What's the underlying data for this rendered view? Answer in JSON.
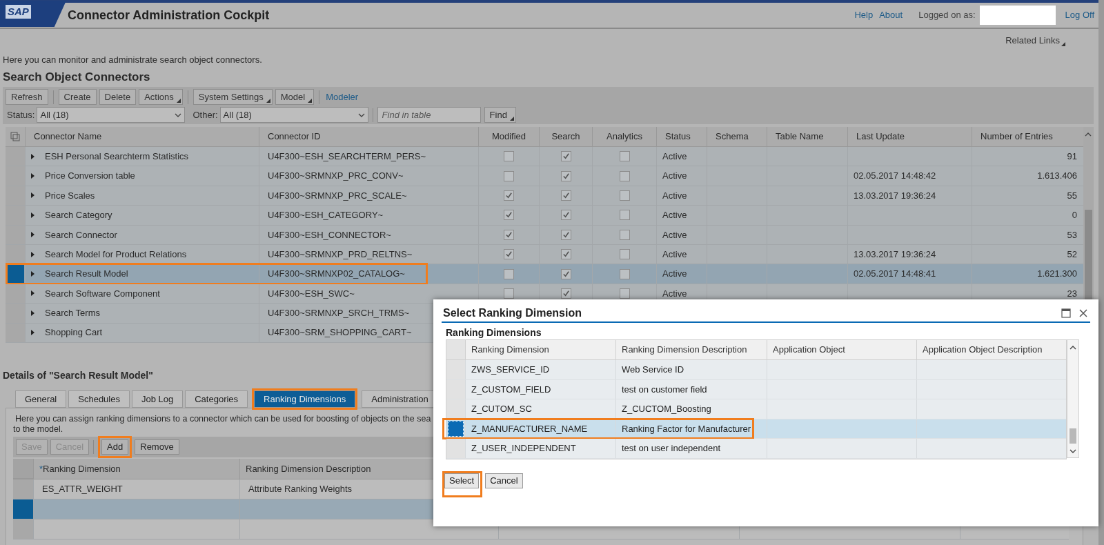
{
  "header": {
    "logo_text": "SAP",
    "title": "Connector Administration Cockpit",
    "links": [
      "Help",
      "About"
    ],
    "logged_on_label": "Logged on as:",
    "log_off": "Log Off"
  },
  "related_links": "Related Links",
  "intro": "Here you can monitor and administrate search object connectors.",
  "connectors": {
    "title": "Search Object Connectors",
    "toolbar_groups": [
      [
        {
          "kind": "button",
          "label": "Refresh"
        }
      ],
      [
        {
          "kind": "button",
          "label": "Create"
        },
        {
          "kind": "button",
          "label": "Delete"
        },
        {
          "kind": "menu",
          "label": "Actions"
        }
      ],
      [
        {
          "kind": "menu",
          "label": "System Settings"
        },
        {
          "kind": "menu",
          "label": "Model"
        }
      ],
      [
        {
          "kind": "link",
          "label": "Modeler"
        }
      ]
    ],
    "filters": [
      {
        "label": "Status:",
        "value": "All (18)"
      },
      {
        "label": "Other:",
        "value": "All (18)"
      }
    ],
    "find": {
      "placeholder": "Find in table",
      "button": "Find"
    },
    "columns": [
      "Connector Name",
      "Connector ID",
      "Modified",
      "Search",
      "Analytics",
      "Status",
      "Schema",
      "Table Name",
      "Last Update",
      "Number of Entries"
    ],
    "rows": [
      {
        "name": "ESH Personal Searchterm Statistics",
        "id": "U4F300~ESH_SEARCHTERM_PERS~",
        "modified": false,
        "search": true,
        "analytics": false,
        "status": "Active",
        "entries": "91",
        "selected": false,
        "highlighted": false
      },
      {
        "name": "Price Conversion table",
        "id": "U4F300~SRMNXP_PRC_CONV~",
        "modified": false,
        "search": true,
        "analytics": false,
        "status": "Active",
        "last_update": "02.05.2017 14:48:42",
        "entries": "1.613.406",
        "selected": false,
        "highlighted": false
      },
      {
        "name": "Price Scales",
        "id": "U4F300~SRMNXP_PRC_SCALE~",
        "modified": true,
        "search": true,
        "analytics": false,
        "status": "Active",
        "last_update": "13.03.2017 19:36:24",
        "entries": "55",
        "selected": false,
        "highlighted": false
      },
      {
        "name": "Search Category",
        "id": "U4F300~ESH_CATEGORY~",
        "modified": true,
        "search": true,
        "analytics": false,
        "status": "Active",
        "entries": "0",
        "selected": false,
        "highlighted": false
      },
      {
        "name": "Search Connector",
        "id": "U4F300~ESH_CONNECTOR~",
        "modified": true,
        "search": true,
        "analytics": false,
        "status": "Active",
        "entries": "53",
        "selected": false,
        "highlighted": false
      },
      {
        "name": "Search Model for Product Relations",
        "id": "U4F300~SRMNXP_PRD_RELTNS~",
        "modified": true,
        "search": true,
        "analytics": false,
        "status": "Active",
        "last_update": "13.03.2017 19:36:24",
        "entries": "52",
        "selected": false,
        "highlighted": false
      },
      {
        "name": "Search Result Model",
        "id": "U4F300~SRMNXP02_CATALOG~",
        "modified": false,
        "search": true,
        "analytics": false,
        "status": "Active",
        "last_update": "02.05.2017 14:48:41",
        "entries": "1.621.300",
        "selected": true,
        "highlighted": true
      },
      {
        "name": "Search Software Component",
        "id": "U4F300~ESH_SWC~",
        "modified": false,
        "search": true,
        "analytics": false,
        "status": "Active",
        "entries": "23",
        "selected": false,
        "highlighted": false
      },
      {
        "name": "Search Terms",
        "id": "U4F300~SRMNXP_SRCH_TRMS~",
        "selected": false,
        "highlighted": false
      },
      {
        "name": "Shopping Cart",
        "id": "U4F300~SRM_SHOPPING_CART~",
        "selected": false,
        "highlighted": false
      }
    ]
  },
  "details": {
    "title": "Details of \"Search Result Model\"",
    "tabs": [
      {
        "label": "General",
        "selected": false,
        "highlighted": false
      },
      {
        "label": "Schedules",
        "selected": false,
        "highlighted": false
      },
      {
        "label": "Job Log",
        "selected": false,
        "highlighted": false
      },
      {
        "label": "Categories",
        "selected": false,
        "highlighted": false
      },
      {
        "label": "Ranking Dimensions",
        "selected": true,
        "highlighted": true
      },
      {
        "label": "Administration",
        "selected": false,
        "highlighted": false
      }
    ],
    "text_lines": [
      "Here you can assign ranking dimensions to a connector which can be used for boosting of objects on the sea",
      "to the model."
    ],
    "toolbar_groups": [
      [
        {
          "label": "Save",
          "disabled": true,
          "highlighted": false
        },
        {
          "label": "Cancel",
          "disabled": true,
          "highlighted": false
        }
      ],
      [
        {
          "label": "Add",
          "disabled": false,
          "highlighted": true
        },
        {
          "label": "Remove",
          "disabled": false,
          "highlighted": false
        }
      ]
    ],
    "columns": [
      {
        "label": "Ranking Dimension",
        "required_marker": "*"
      },
      {
        "label": "Ranking Dimension Description"
      }
    ],
    "rows": [
      {
        "dimension": "ES_ATTR_WEIGHT",
        "description": "Attribute Ranking Weights",
        "selected": false
      },
      {
        "selected": true
      },
      {
        "selected": false
      }
    ]
  },
  "dialog": {
    "title": "Select Ranking Dimension",
    "section": "Ranking Dimensions",
    "columns": [
      "Ranking Dimension",
      "Ranking Dimension Description",
      "Application Object",
      "Application Object Description"
    ],
    "rows": [
      {
        "dimension": "ZWS_SERVICE_ID",
        "description": "Web Service ID",
        "selected": false,
        "highlighted": false
      },
      {
        "dimension": "Z_CUSTOM_FIELD",
        "description": "test on customer field",
        "selected": false,
        "highlighted": false
      },
      {
        "dimension": "Z_CUTOM_SC",
        "description": "Z_CUCTOM_Boosting",
        "selected": false,
        "highlighted": false
      },
      {
        "dimension": "Z_MANUFACTURER_NAME",
        "description": "Ranking Factor for Manufacturer",
        "selected": true,
        "highlighted": true
      },
      {
        "dimension": "Z_USER_INDEPENDENT",
        "description": "test on user independent",
        "selected": false,
        "highlighted": false
      }
    ],
    "buttons": [
      {
        "label": "Select",
        "highlighted": true
      },
      {
        "label": "Cancel",
        "highlighted": false
      }
    ]
  }
}
